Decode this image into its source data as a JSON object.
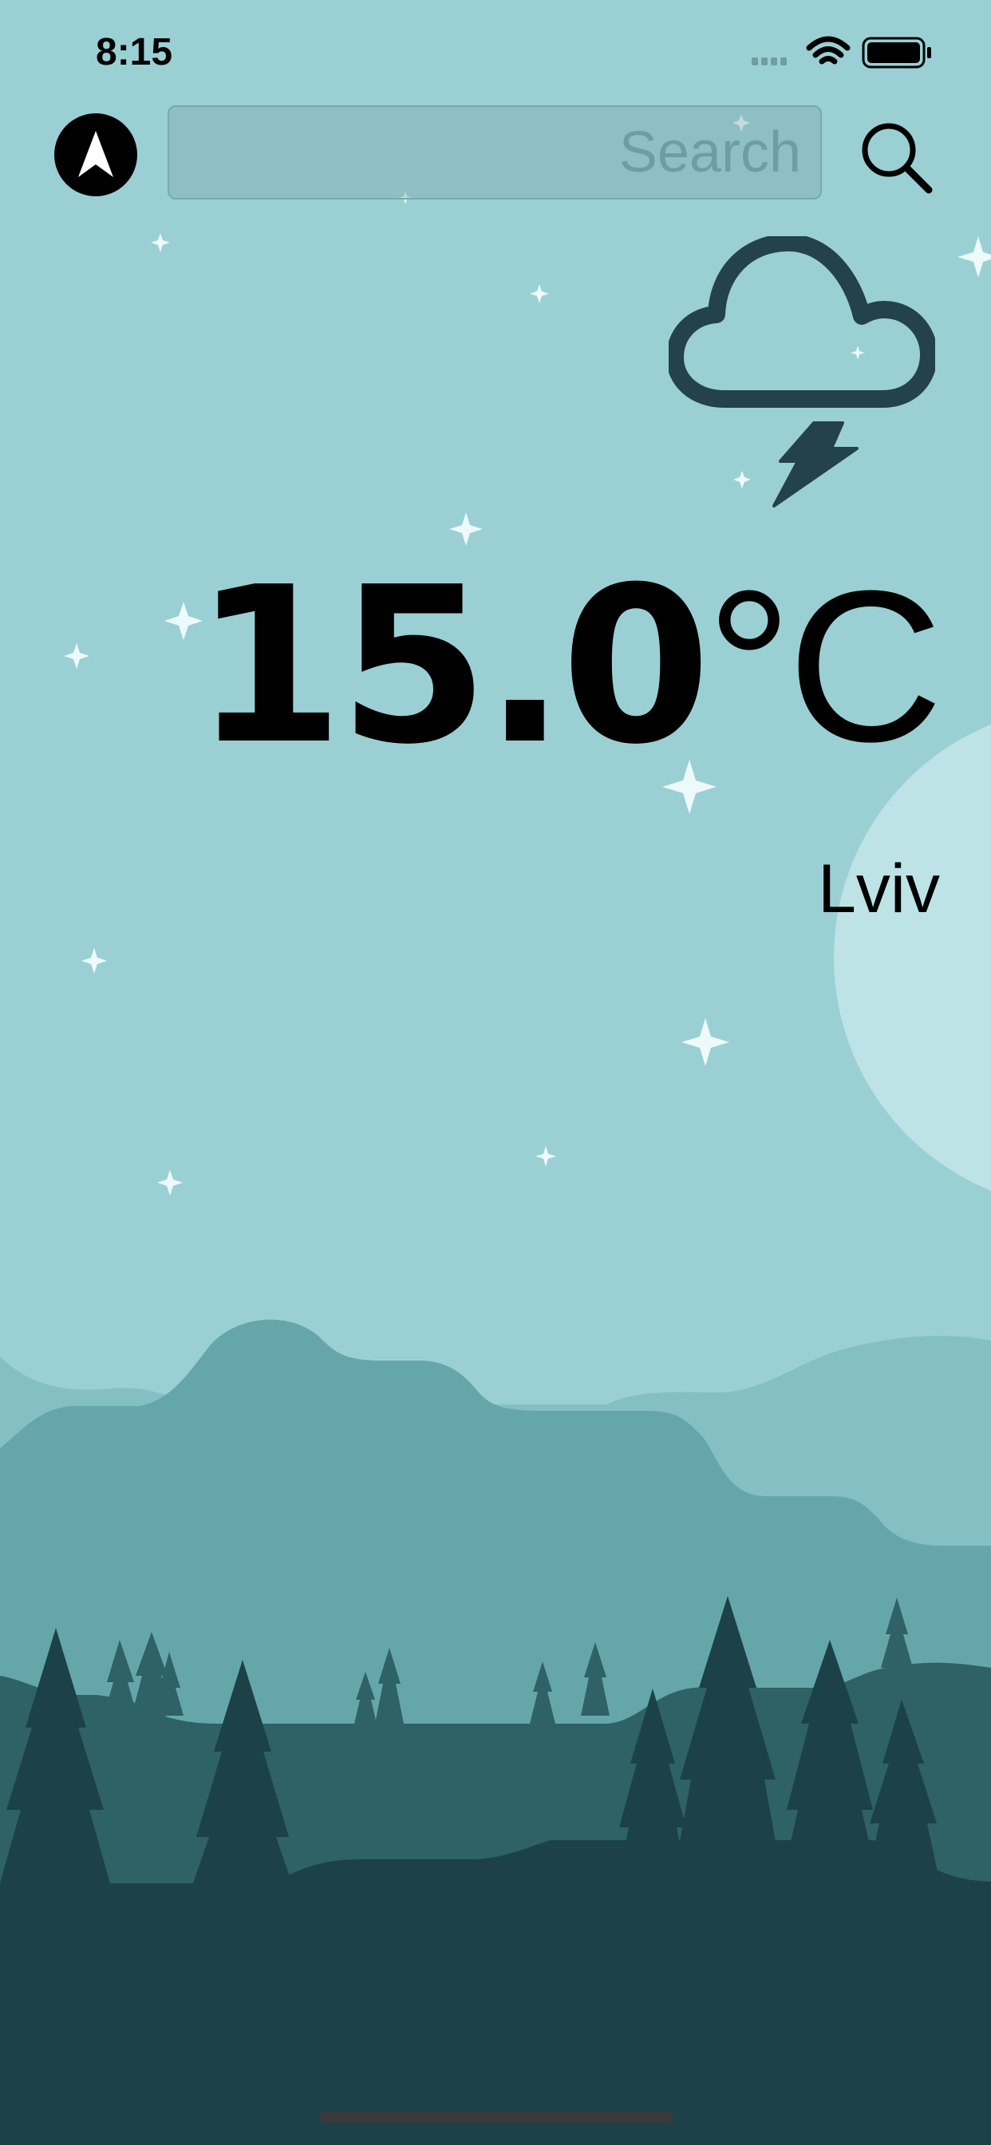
{
  "status_bar": {
    "time": "8:15",
    "icons": [
      "cellular-signal-icon",
      "wifi-icon",
      "battery-icon"
    ]
  },
  "header": {
    "location_icon": "navigation-arrow-icon",
    "search": {
      "value": "",
      "placeholder": "Search"
    },
    "search_icon": "magnifier-icon"
  },
  "weather": {
    "condition_icon": "cloud-lightning-icon",
    "temperature_value": "15.0",
    "temperature_unit": "°C",
    "city": "Lviv"
  },
  "colors": {
    "sky": "#9ad0d4",
    "moon": "#bde3e6",
    "hill_back": "#84bfc3",
    "hill_mid": "#65a6ab",
    "hill_front": "#2e6266",
    "ground": "#1c4148",
    "icon": "#234249",
    "star": "#eef9fa"
  }
}
